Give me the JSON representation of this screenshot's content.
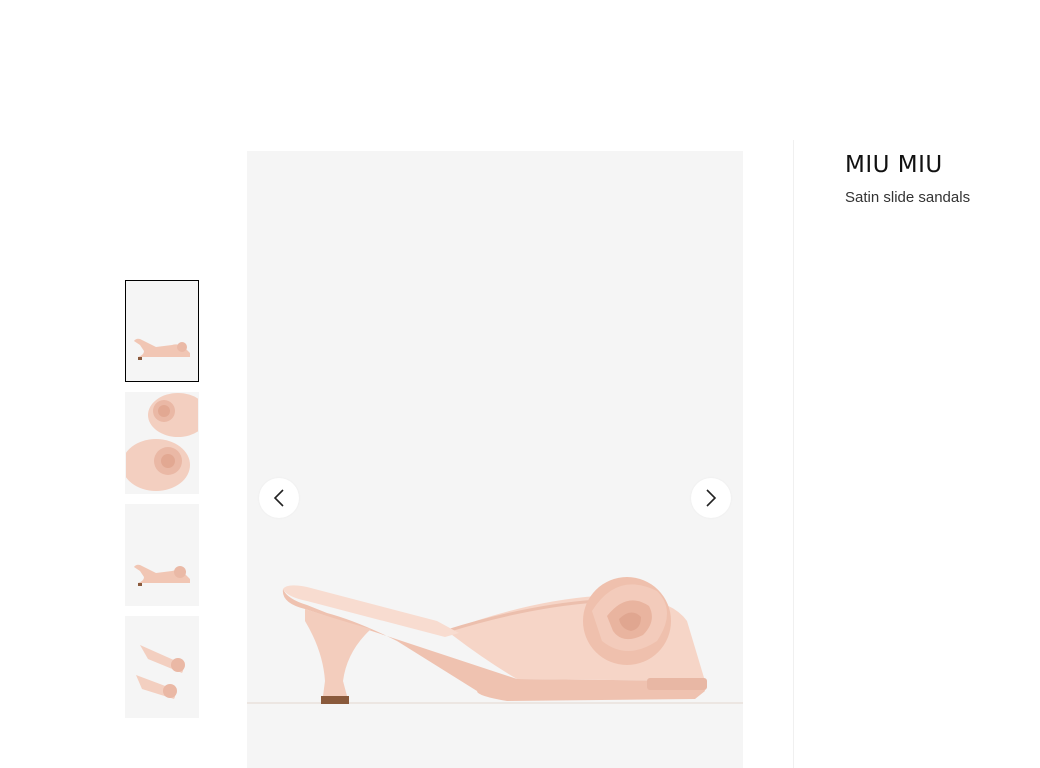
{
  "product": {
    "brand": "MIU MIU",
    "name": "Satin slide sandals"
  },
  "gallery": {
    "thumbnails": [
      {
        "alt": "side-view",
        "active": true
      },
      {
        "alt": "top-view-pair",
        "active": false
      },
      {
        "alt": "side-view-small",
        "active": false
      },
      {
        "alt": "pair-angled-view",
        "active": false
      }
    ],
    "prev_icon": "chevron-left-icon",
    "next_icon": "chevron-right-icon"
  },
  "colors": {
    "image_background": "#f5f5f5",
    "satin_pink": "#f2c9b8",
    "heel_tip": "#8a5a3c"
  }
}
